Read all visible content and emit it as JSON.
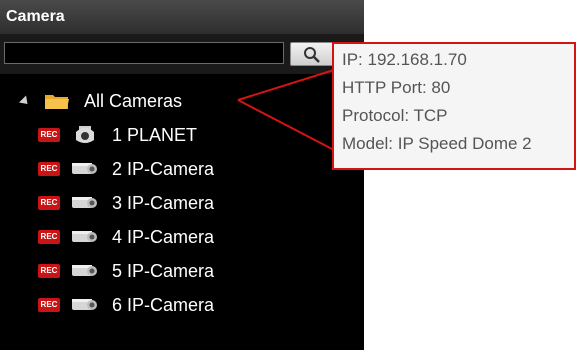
{
  "panel": {
    "title": "Camera",
    "search": {
      "value": "",
      "placeholder": ""
    }
  },
  "tree": {
    "root_label": "All Cameras",
    "items": [
      {
        "badge": "REC",
        "label": "1 PLANET",
        "icon": "dome-camera-icon"
      },
      {
        "badge": "REC",
        "label": "2 IP-Camera",
        "icon": "box-camera-icon"
      },
      {
        "badge": "REC",
        "label": "3 IP-Camera",
        "icon": "box-camera-icon"
      },
      {
        "badge": "REC",
        "label": "4 IP-Camera",
        "icon": "box-camera-icon"
      },
      {
        "badge": "REC",
        "label": "5 IP-Camera",
        "icon": "box-camera-icon"
      },
      {
        "badge": "REC",
        "label": "6 IP-Camera",
        "icon": "box-camera-icon"
      }
    ]
  },
  "tooltip": {
    "ip": "IP: 192.168.1.70",
    "http_port": "HTTP Port: 80",
    "protocol": "Protocol: TCP",
    "model": "Model: IP Speed Dome 2"
  },
  "colors": {
    "rec_badge": "#c81414",
    "tooltip_border": "#d41414",
    "panel_bg": "#000000"
  }
}
